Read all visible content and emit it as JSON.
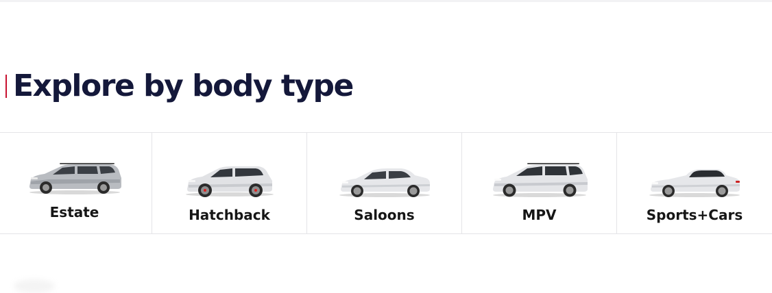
{
  "section": {
    "title": "Explore by body type",
    "accent_color": "#c8102e",
    "title_color": "#14183a"
  },
  "body_types": [
    {
      "label": "Estate",
      "icon": "estate-car-icon"
    },
    {
      "label": "Hatchback",
      "icon": "hatchback-car-icon"
    },
    {
      "label": "Saloons",
      "icon": "saloon-car-icon"
    },
    {
      "label": "MPV",
      "icon": "mpv-car-icon"
    },
    {
      "label": "Sports+Cars",
      "icon": "sports-car-icon"
    }
  ]
}
